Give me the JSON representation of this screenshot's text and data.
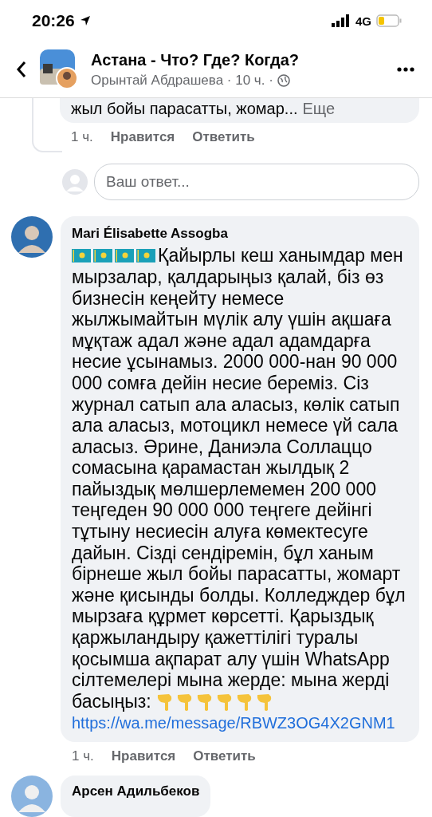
{
  "status_bar": {
    "time": "20:26",
    "network": "4G"
  },
  "header": {
    "title": "Астана - Что? Где? Когда?",
    "subtitle": "Орынтай Абдрашева · 10 ч. ·"
  },
  "previous_reply": {
    "excerpt": "жыл бойы парасатты, жомар...",
    "more": "Еще",
    "time": "1 ч.",
    "actions": [
      "Нравится",
      "Ответить"
    ]
  },
  "reply_field": {
    "placeholder": "Ваш ответ..."
  },
  "comment": {
    "author": "Mari Élisabette Assogba",
    "text": "Қайырлы кеш ханымдар мен мырзалар, қалдарыңыз қалай, біз өз бизнесін кеңейту немесе жылжымайтын мүлік алу үшін ақшаға мұқтаж адал және адал адамдарға несие ұсынамыз. 2000 000-нан 90 000 000 сомға дейін несие береміз. Сіз журнал сатып ала аласыз, көлік сатып ала аласыз, мотоцикл немесе үй сала аласыз. Әрине, Даниэла Соллаццо сомасына қарамастан жылдық 2 пайыздық мөлшерлемемен 200 000 теңгеден 90 000 000 теңгеге дейінгі тұтыну несиесін алуға көмектесуге дайын. Сізді сендіремін, бұл ханым бірнеше жыл бойы парасатты, жомарт және қисынды болды. Колледждер бұл мырзаға құрмет көрсетті. Қарыздық қаржыландыру қажеттілігі туралы қосымша ақпарат алу үшін WhatsApp сілтемелері мына жерде: мына жерді басыңыз:",
    "link": "https://wa.me/message/RBWZ3OG4X2GNM1",
    "time": "1 ч.",
    "actions": [
      "Нравится",
      "Ответить"
    ]
  },
  "next_comment": {
    "author": "Арсен Адильбеков"
  }
}
